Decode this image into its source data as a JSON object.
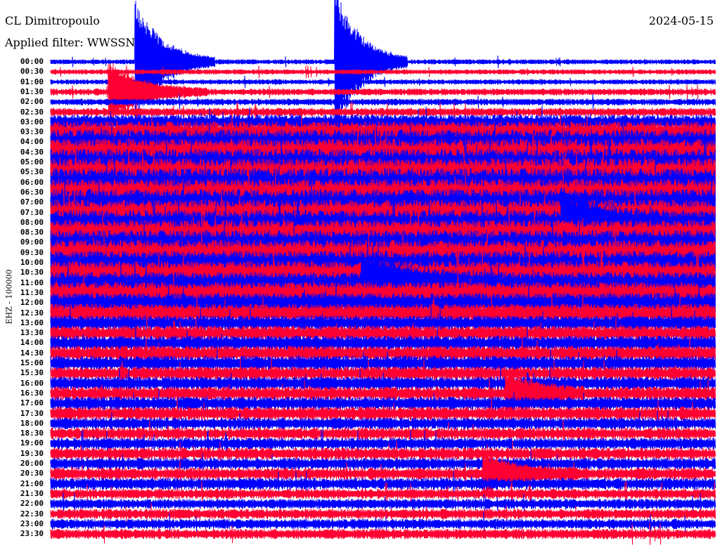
{
  "header": {
    "station": "CL Dimitropoulo",
    "date": "2024-05-15",
    "filter": "Applied filter: WWSSN-SP"
  },
  "chart_data": {
    "type": "line",
    "title": "CL Dimitropoulo",
    "ylabel": "EHZ - 100000",
    "row_minutes": 30,
    "colors": [
      "#0000ff",
      "#ff0033"
    ],
    "row_labels": [
      "00:00",
      "00:30",
      "01:00",
      "01:30",
      "02:00",
      "02:30",
      "03:00",
      "03:30",
      "04:00",
      "04:30",
      "05:00",
      "05:30",
      "06:00",
      "06:30",
      "07:00",
      "07:30",
      "08:00",
      "08:30",
      "09:00",
      "09:30",
      "10:00",
      "10:30",
      "11:00",
      "11:30",
      "12:00",
      "12:30",
      "13:00",
      "13:30",
      "14:00",
      "14:30",
      "15:00",
      "15:30",
      "16:00",
      "16:30",
      "17:00",
      "17:30",
      "18:00",
      "18:30",
      "19:00",
      "19:30",
      "20:00",
      "20:30",
      "21:00",
      "21:30",
      "22:00",
      "22:30",
      "23:00",
      "23:30"
    ],
    "relative_noise_level": [
      3,
      3,
      3,
      4,
      4,
      5,
      9,
      13,
      15,
      16,
      16,
      17,
      17,
      16,
      16,
      15,
      15,
      15,
      15,
      15,
      14,
      14,
      13,
      13,
      12,
      11,
      9,
      9,
      9,
      9,
      9,
      8,
      8,
      8,
      8,
      8,
      7,
      7,
      7,
      7,
      7,
      7,
      7,
      6,
      6,
      6,
      6,
      6
    ],
    "events": [
      {
        "row": 0,
        "minute": 3.8,
        "amplitude": 90,
        "duration_min": 1.2
      },
      {
        "row": 0,
        "minute": 12.8,
        "amplitude": 110,
        "duration_min": 1.1
      },
      {
        "row": 3,
        "minute": 2.6,
        "amplitude": 40,
        "duration_min": 1.5
      },
      {
        "row": 22,
        "minute": 14.0,
        "amplitude": 35,
        "duration_min": 2.0
      },
      {
        "row": 16,
        "minute": 23.0,
        "amplitude": 40,
        "duration_min": 1.5
      },
      {
        "row": 33,
        "minute": 20.5,
        "amplitude": 30,
        "duration_min": 1.2
      },
      {
        "row": 41,
        "minute": 19.5,
        "amplitude": 25,
        "duration_min": 1.5
      }
    ]
  }
}
